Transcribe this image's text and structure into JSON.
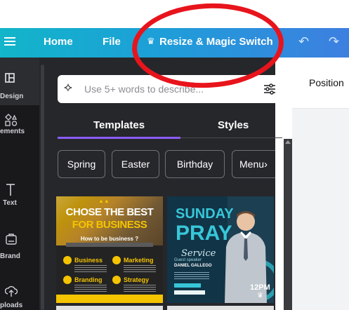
{
  "topbar": {
    "home": "Home",
    "file": "File",
    "resize": "Resize & Magic Switch",
    "crown_glyph": "♛",
    "undo_glyph": "↶",
    "redo_glyph": "↷"
  },
  "rail": {
    "items": [
      {
        "label": "Design",
        "icon": "layout-icon"
      },
      {
        "label": "ements",
        "icon": "elements-icon"
      },
      {
        "label": "Text",
        "icon": "text-icon"
      },
      {
        "label": "Brand",
        "icon": "brand-icon"
      },
      {
        "label": "ploads",
        "icon": "upload-icon"
      }
    ]
  },
  "search": {
    "placeholder": "Use 5+ words to describe..."
  },
  "tabs": {
    "templates": "Templates",
    "styles": "Styles"
  },
  "chips": [
    "Spring",
    "Easter",
    "Birthday",
    "Menu"
  ],
  "right_panel": {
    "title": "Position"
  },
  "templates": {
    "card1": {
      "line1": "CHOSE THE BEST",
      "line2": "FOR BUSINESS",
      "question": "How to be business ?",
      "items": [
        "Business",
        "Marketing",
        "Branding",
        "Strategy"
      ]
    },
    "card2": {
      "line1": "SUNDAY",
      "line2": "PRAY",
      "line3": "Service",
      "time": "12PM",
      "speaker_label": "Guest speaker",
      "speaker_name": "DANIEL GALLEGO"
    }
  },
  "colors": {
    "topbar_start": "#12b5c9",
    "topbar_end": "#3d7fe0",
    "annotation_ring": "#e8141c",
    "tab_active": "#8b5cf6"
  }
}
